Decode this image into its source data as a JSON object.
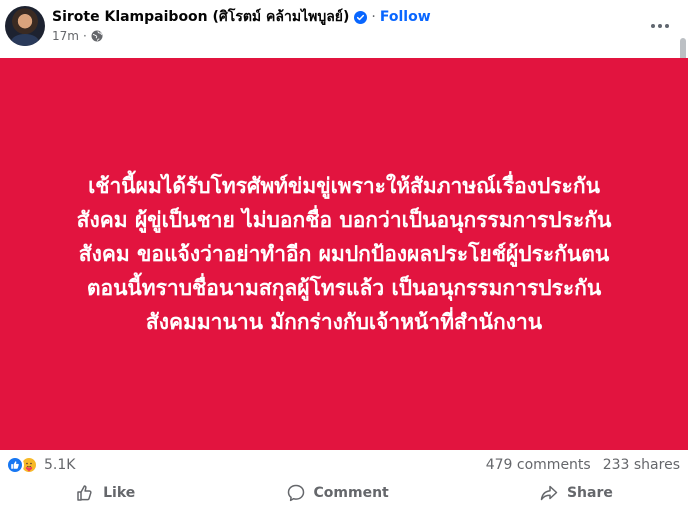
{
  "post": {
    "author_name": "Sirote Klampaiboon (ศิโรตม์ คล้ามไพบูลย์)",
    "follow_label": "Follow",
    "separator": "·",
    "timestamp": "17m",
    "audience_icon": "globe-icon",
    "verified_icon": "verified-badge-icon",
    "more_icon": "more-options-icon",
    "body_lines": [
      "เช้านี้ผมได้รับโทรศัพท์ข่มขู่เพราะให้สัมภาษณ์เรื่องประกัน",
      "สังคม ผู้ขู่เป็นชาย ไม่บอกชื่อ บอกว่าเป็นอนุกรรมการประกัน",
      "สังคม ขอแจ้งว่าอย่าทำอีก ผมปกป้องผลประโยช์ผู้ประกันตน",
      "ตอนนี้ทราบชื่อนามสกุลผู้โทรแล้ว เป็นอนุกรรมการประกัน",
      "สังคมมานาน มักกร่างกับเจ้าหน้าที่สำนักงาน"
    ],
    "background_color": "#e2143f"
  },
  "stats": {
    "reaction_icons": [
      "like-reaction-icon",
      "care-reaction-icon"
    ],
    "reaction_count": "5.1K",
    "comments": "479 comments",
    "shares": "233 shares"
  },
  "actions": {
    "like": "Like",
    "comment": "Comment",
    "share": "Share"
  },
  "colors": {
    "accent": "#0866ff",
    "muted_text": "#65676b"
  }
}
